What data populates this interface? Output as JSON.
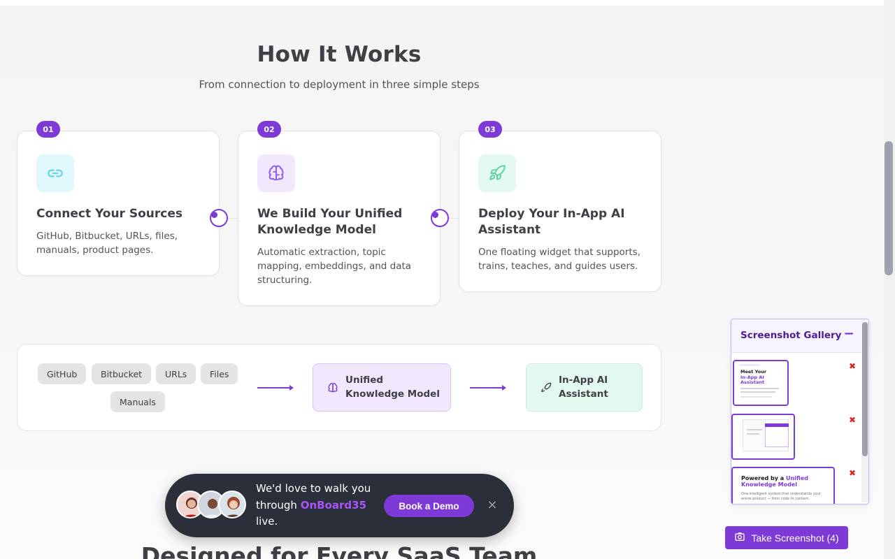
{
  "section": {
    "title": "How It Works",
    "subtitle": "From connection to deployment in three simple steps"
  },
  "steps": [
    {
      "number": "01",
      "icon": "link-icon",
      "title": "Connect Your Sources",
      "description": "GitHub, Bitbucket, URLs, files, manuals, product pages."
    },
    {
      "number": "02",
      "icon": "brain-icon",
      "title": "We Build Your Unified Knowledge Model",
      "description": "Automatic extraction, topic mapping, embeddings, and data structuring."
    },
    {
      "number": "03",
      "icon": "rocket-icon",
      "title": "Deploy Your In-App AI Assistant",
      "description": "One floating widget that supports, trains, teaches, and guides users."
    }
  ],
  "flow": {
    "sources": [
      "GitHub",
      "Bitbucket",
      "URLs",
      "Files",
      "Manuals"
    ],
    "model_label": "Unified Knowledge Model",
    "assistant_label": "In-App AI Assistant"
  },
  "next_section": {
    "title": "Designed for Every SaaS Team"
  },
  "toast": {
    "line1": "We'd love to walk you",
    "line2_prefix": "through ",
    "brand": "OnBoard35",
    "line3": "live.",
    "button": "Book a Demo",
    "close": "×"
  },
  "gallery": {
    "title": "Screenshot Gallery",
    "minimize": "−",
    "shot1_line1": "Meet Your",
    "shot1_line2": "In-App AI",
    "shot1_line3": "Assistant",
    "shot3_prefix": "Powered by a ",
    "shot3_highlight": "Unified",
    "shot3_line2": "Knowledge Model",
    "shot3_desc": "One intelligent system that understands your entire product — from code to content.",
    "delete": "✖"
  },
  "take_button": "Take Screenshot (4)",
  "colors": {
    "accent": "#7e3ad6",
    "link_bg": "#e0f7fb",
    "brain_bg": "#f1e8fd",
    "rocket_bg": "#e3f9ef"
  }
}
